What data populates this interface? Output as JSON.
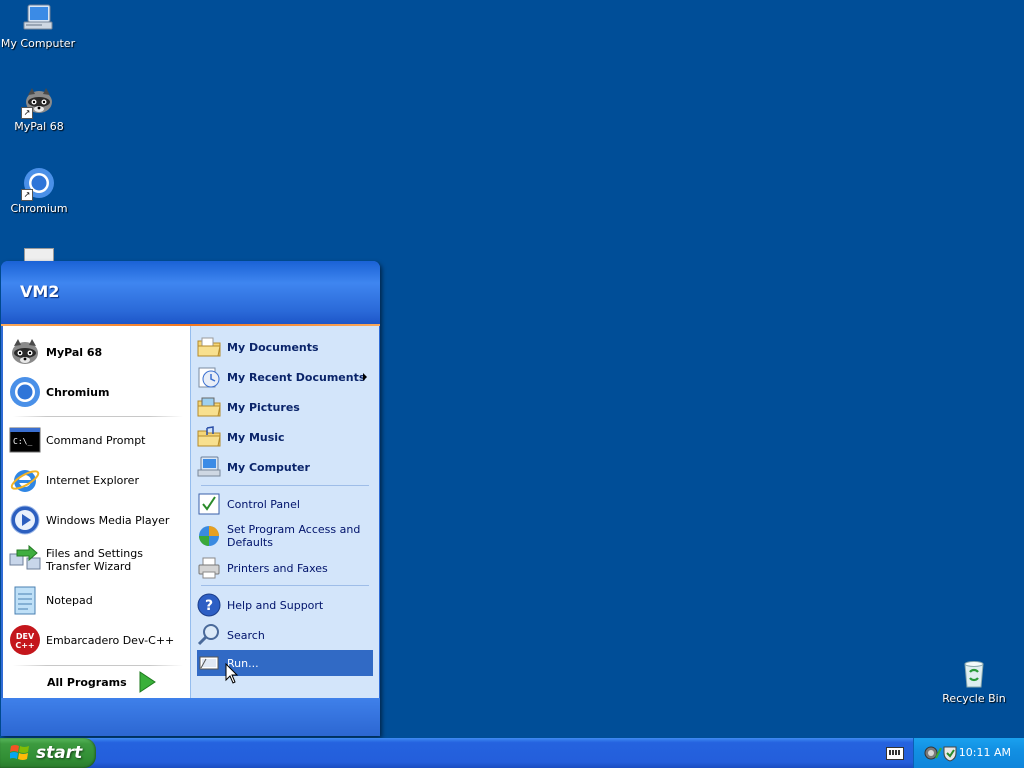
{
  "desktop": {
    "icons": [
      {
        "label": "My Computer",
        "icon": "computer-icon"
      },
      {
        "label": "MyPal 68",
        "icon": "raccoon-icon"
      },
      {
        "label": "Chromium",
        "icon": "chromium-icon"
      },
      {
        "label": "Recycle Bin",
        "icon": "recycle-bin-icon"
      }
    ]
  },
  "start_menu": {
    "user": "VM2",
    "pinned": [
      {
        "label": "MyPal 68",
        "icon": "raccoon-icon"
      },
      {
        "label": "Chromium",
        "icon": "chromium-icon"
      }
    ],
    "recent": [
      {
        "label": "Command Prompt",
        "icon": "command-prompt-icon"
      },
      {
        "label": "Internet Explorer",
        "icon": "internet-explorer-icon"
      },
      {
        "label": "Windows Media Player",
        "icon": "media-player-icon"
      },
      {
        "label": "Files and Settings Transfer Wizard",
        "icon": "transfer-wizard-icon"
      },
      {
        "label": "Notepad",
        "icon": "notepad-icon"
      },
      {
        "label": "Embarcadero Dev-C++",
        "icon": "devcpp-icon"
      }
    ],
    "all_programs": "All Programs",
    "right": [
      {
        "label": "My Documents",
        "icon": "folder-documents-icon"
      },
      {
        "label": "My Recent Documents",
        "icon": "recent-documents-icon"
      },
      {
        "label": "My Pictures",
        "icon": "folder-pictures-icon"
      },
      {
        "label": "My Music",
        "icon": "folder-music-icon"
      },
      {
        "label": "My Computer",
        "icon": "computer-icon"
      },
      {
        "label": "Control Panel",
        "icon": "control-panel-icon"
      },
      {
        "label": "Set Program Access and Defaults",
        "icon": "program-access-icon"
      },
      {
        "label": "Printers and Faxes",
        "icon": "printer-icon"
      },
      {
        "label": "Help and Support",
        "icon": "help-icon"
      },
      {
        "label": "Search",
        "icon": "search-icon"
      },
      {
        "label": "Run...",
        "icon": "run-icon"
      }
    ]
  },
  "taskbar": {
    "start_label": "start",
    "clock": "10:11 AM"
  }
}
